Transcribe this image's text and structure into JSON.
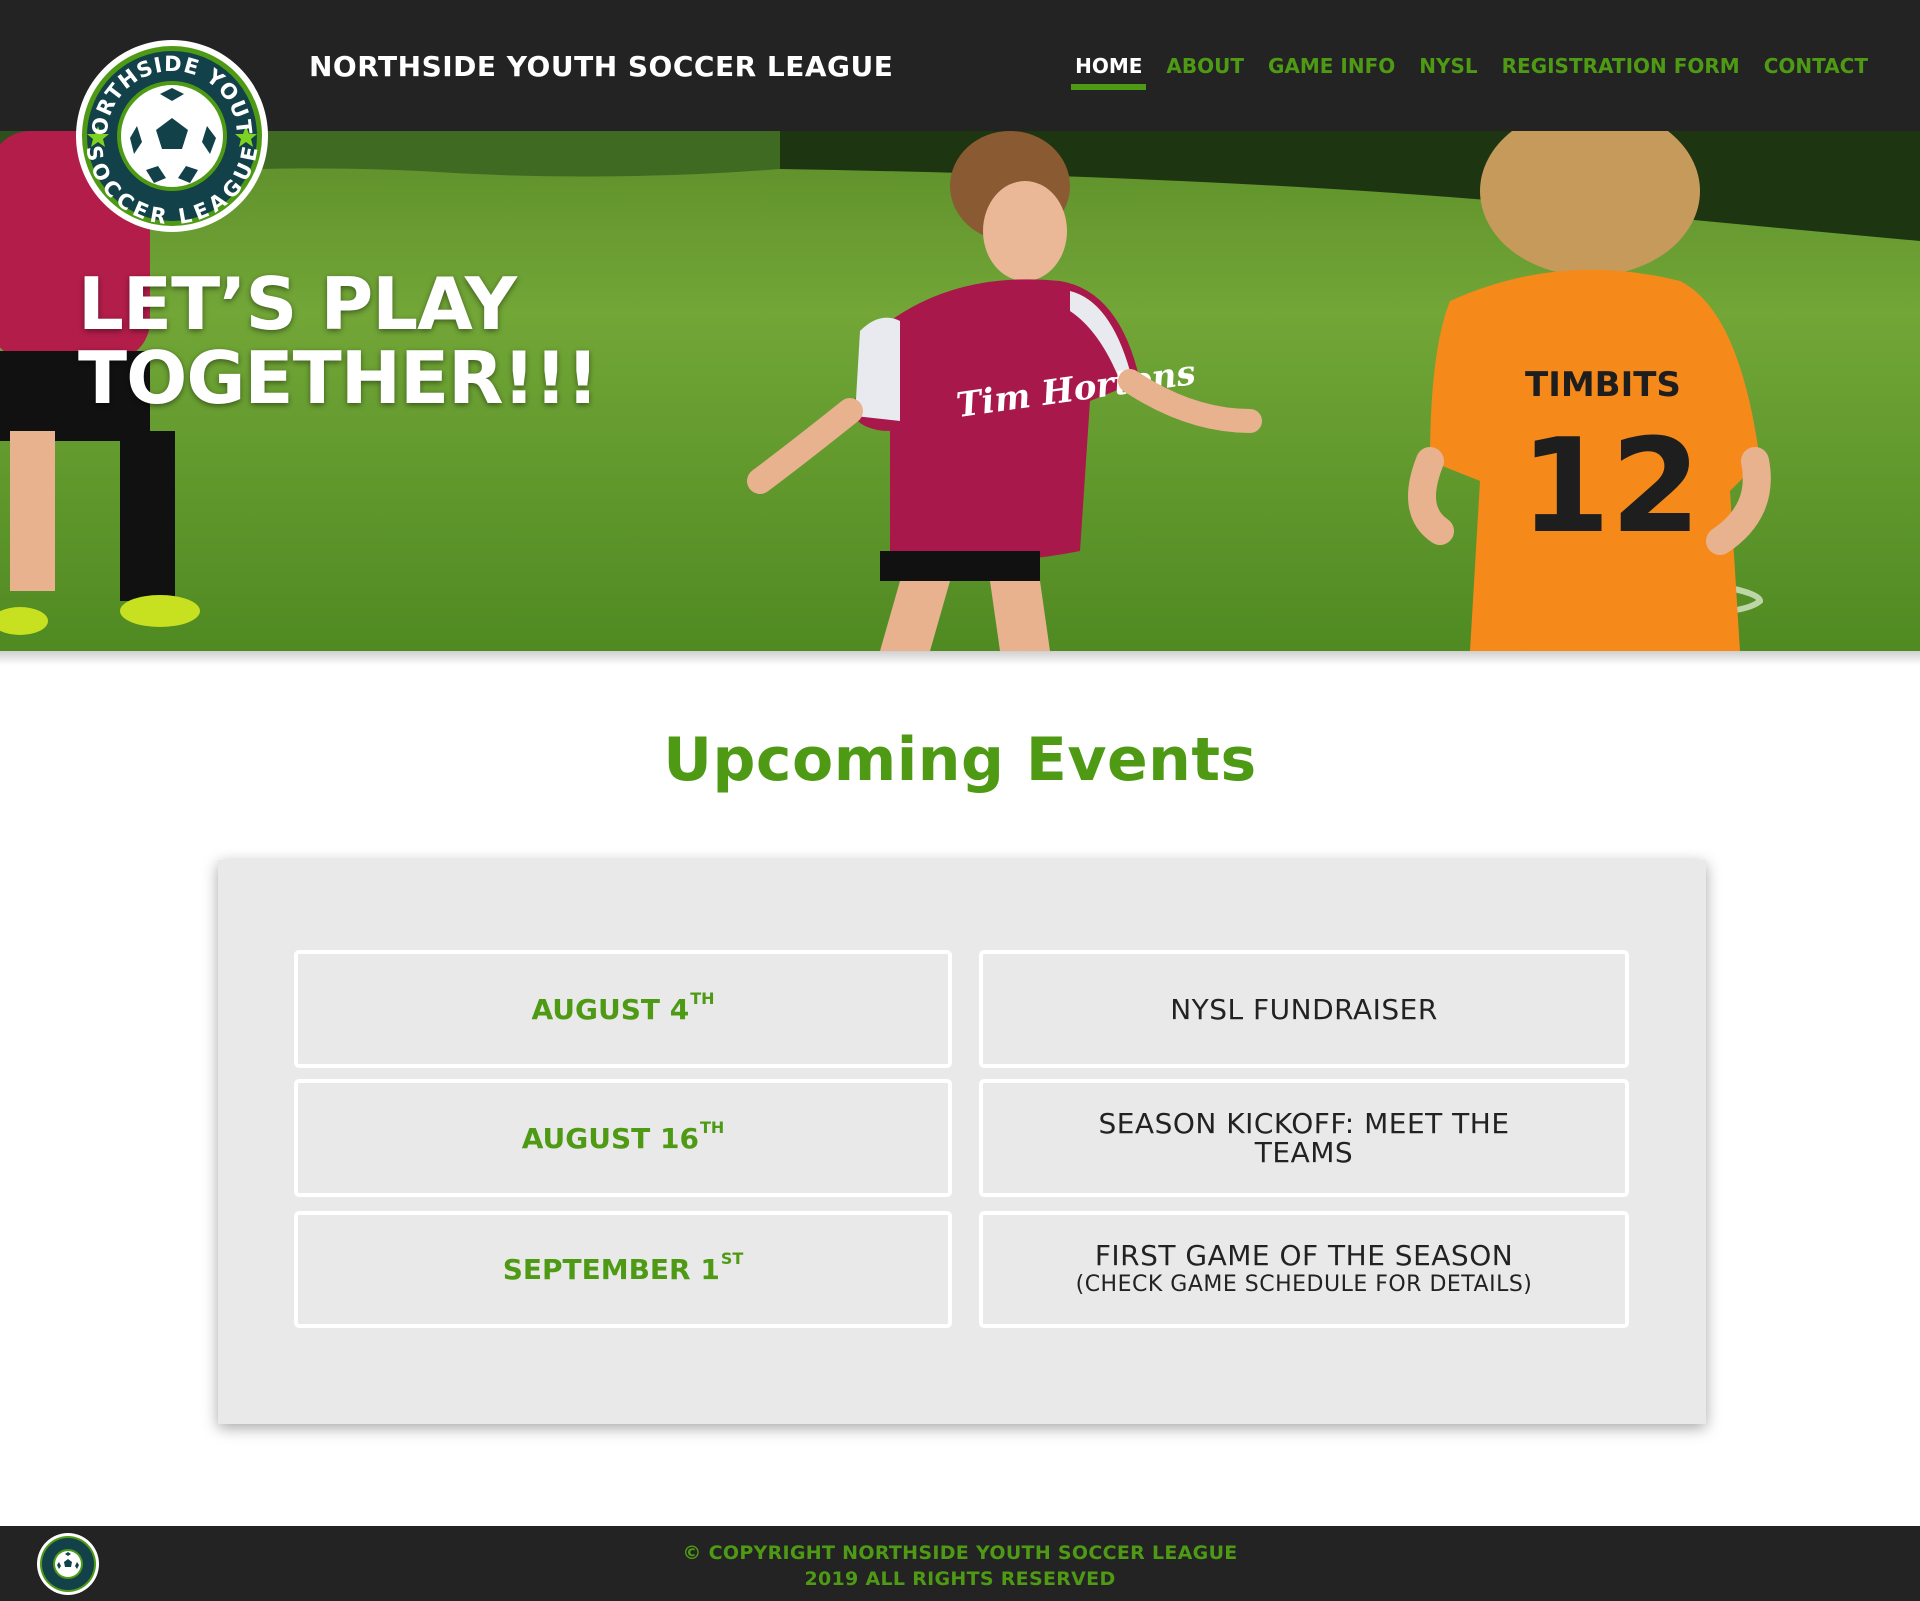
{
  "header": {
    "site_title": "NORTHSIDE YOUTH SOCCER LEAGUE",
    "logo": {
      "top_text": "NORTHSIDE YOUTH",
      "bottom_text": "SOCCER LEAGUE"
    }
  },
  "nav": {
    "items": [
      {
        "label": "HOME",
        "active": true
      },
      {
        "label": "ABOUT",
        "active": false
      },
      {
        "label": "GAME INFO",
        "active": false
      },
      {
        "label": "NYSL",
        "active": false
      },
      {
        "label": "REGISTRATION FORM",
        "active": false
      },
      {
        "label": "CONTACT",
        "active": false
      }
    ]
  },
  "hero": {
    "title_line1": "LET’S PLAY",
    "title_line2": "TOGETHER!!!",
    "jersey_sponsor": "Tim Hortons",
    "jersey_team": "TIMBITS",
    "jersey_number": "12"
  },
  "events": {
    "heading": "Upcoming Events",
    "items": [
      {
        "date": "AUGUST 4",
        "date_suffix": "TH",
        "title": "NYSL FUNDRAISER",
        "note": ""
      },
      {
        "date": "AUGUST 16",
        "date_suffix": "TH",
        "title": "SEASON KICKOFF: MEET THE TEAMS",
        "note": ""
      },
      {
        "date": "SEPTEMBER 1",
        "date_suffix": "ST",
        "title": "FIRST GAME OF THE SEASON",
        "note": "(CHECK GAME SCHEDULE FOR DETAILS)"
      }
    ]
  },
  "footer": {
    "line1": "© COPYRIGHT NORTHSIDE YOUTH SOCCER LEAGUE",
    "line2": "2019 ALL RIGHTS RESERVED"
  },
  "colors": {
    "brand_green": "#4e9a14",
    "header_bg": "#232323",
    "panel_bg": "#e9e9e9"
  }
}
